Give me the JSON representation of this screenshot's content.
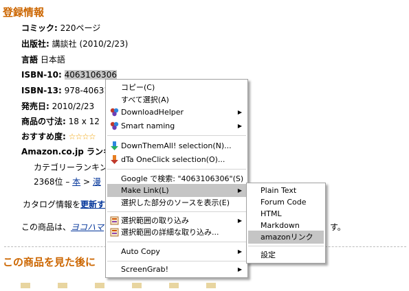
{
  "section_title": "登録情報",
  "details": {
    "comic_label": "コミック:",
    "comic_value": "220ページ",
    "publisher_label": "出版社:",
    "publisher_value": "講談社 (2010/2/23)",
    "language_label": "言語",
    "language_value": "日本語",
    "isbn10_label": "ISBN-10:",
    "isbn10_value": "4063106306",
    "isbn13_label": "ISBN-13:",
    "isbn13_value": "978-406310",
    "release_label": "発売日:",
    "release_value": "2010/2/23",
    "dimensions_label": "商品の寸法:",
    "dimensions_value": "18 x 12",
    "rating_label": "おすすめ度:",
    "rating_stars": "☆☆☆☆",
    "ranking_label": "Amazon.co.jp ランキ",
    "category_ranking": "カテゴリーランキン",
    "rank_text": "2368位 – ",
    "rank_link1": "本",
    "rank_sep": " > ",
    "rank_link2": "漫",
    "catalog_text": "カタログ情報を",
    "catalog_link": "更新す",
    "product_text": "この商品は、",
    "product_link": "ヨコハマ",
    "product_tail": "す。"
  },
  "also_viewed_title": "この商品を見た後に",
  "context_menu": {
    "items": [
      {
        "label": "コピー(C)",
        "icon": "",
        "submenu": false
      },
      {
        "label": "すべて選択(A)",
        "icon": "",
        "submenu": false
      },
      {
        "label": "DownloadHelper",
        "icon": "downloadhelper-icon",
        "submenu": true
      },
      {
        "label": "Smart naming",
        "icon": "downloadhelper-icon",
        "submenu": true
      },
      {
        "label": "DownThemAll! selection(N)...",
        "icon": "downthemall-icon",
        "submenu": false
      },
      {
        "label": "dTa OneClick selection(O)...",
        "icon": "dta-oneclick-icon",
        "submenu": false
      },
      {
        "label": "Google で検索: \"4063106306\"(S)",
        "icon": "",
        "submenu": false
      },
      {
        "label": "Make Link(L)",
        "icon": "",
        "submenu": true
      },
      {
        "label": "選択した部分のソースを表示(E)",
        "icon": "",
        "submenu": false
      },
      {
        "label": "選択範囲の取り込み",
        "icon": "scrapbook-icon",
        "submenu": true
      },
      {
        "label": "選択範囲の詳細な取り込み...",
        "icon": "scrapbook-icon",
        "submenu": false
      },
      {
        "label": "Auto Copy",
        "icon": "",
        "submenu": true
      },
      {
        "label": "ScreenGrab!",
        "icon": "",
        "submenu": true
      }
    ]
  },
  "make_link_menu": {
    "items": [
      "Plain Text",
      "Forum Code",
      "HTML",
      "Markdown",
      "amazonリンク",
      "設定"
    ]
  }
}
